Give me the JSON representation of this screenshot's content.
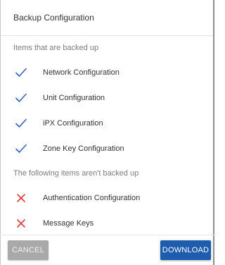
{
  "dialog": {
    "title": "Backup Configuration"
  },
  "backed_up": {
    "heading": "Items that are backed up",
    "icon": "check-icon",
    "icon_color": "#2f67b5",
    "items": [
      {
        "label": "Network Configuration"
      },
      {
        "label": "Unit Configuration"
      },
      {
        "label": "iPX Configuration"
      },
      {
        "label": "Zone Key Configuration"
      }
    ]
  },
  "not_backed_up": {
    "heading": "The following items aren't backed up",
    "icon": "close-icon",
    "icon_color": "#e03a3a",
    "items": [
      {
        "label": "Authentication Configuration"
      },
      {
        "label": "Message Keys"
      }
    ]
  },
  "footer": {
    "cancel_label": "CANCEL",
    "download_label": "DOWNLOAD",
    "download_color": "#1e5cad",
    "cancel_color": "#a9a9a9"
  }
}
